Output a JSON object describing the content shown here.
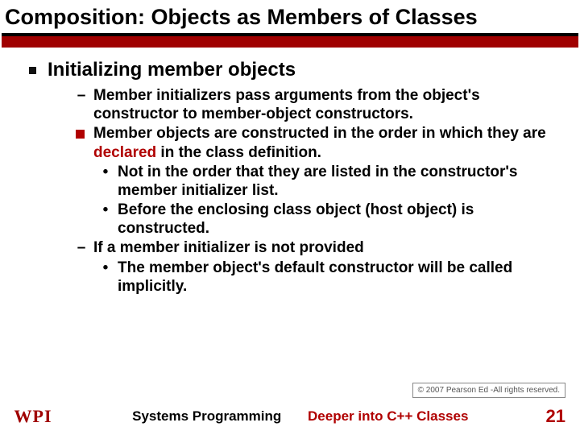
{
  "title": "Composition: Objects as Members of Classes",
  "heading": "Initializing member objects",
  "bullets": {
    "b1": "Member initializers pass arguments from the object's constructor to member-object constructors.",
    "b2a": "Member objects are constructed in the order in which they are ",
    "b2_hl": "declared",
    "b2b": " in the class definition.",
    "b2_1": "Not in the order that they are listed in the constructor's member initializer list.",
    "b2_2": "Before the enclosing class object (host object) is constructed.",
    "b3": "If a member initializer is not provided",
    "b3_1": "The member object's default constructor will be called implicitly."
  },
  "copyright": "© 2007 Pearson Ed -All rights reserved.",
  "footer": {
    "left": "Systems Programming",
    "right": "Deeper into C++ Classes",
    "logo": "WPI",
    "page": "21"
  }
}
